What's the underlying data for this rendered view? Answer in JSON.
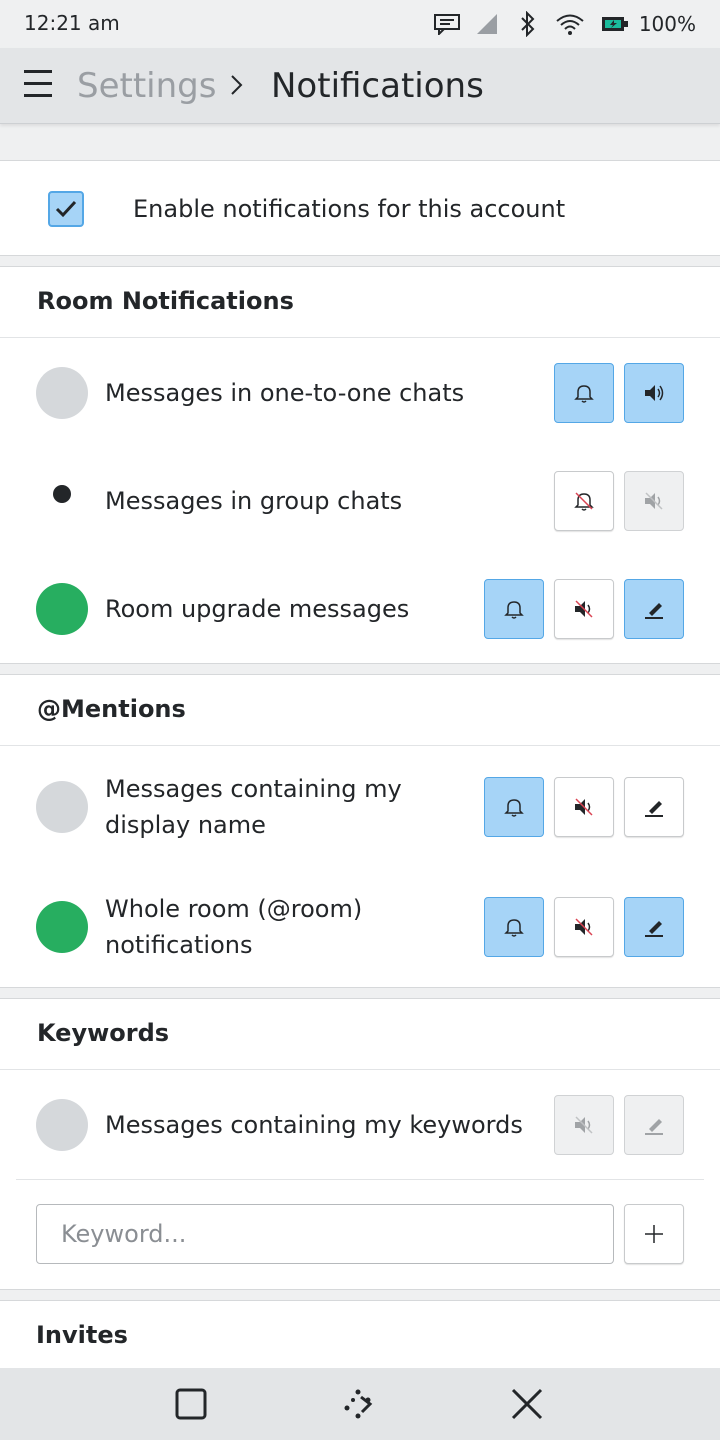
{
  "status_bar": {
    "time": "12:21 am",
    "battery": "100%",
    "icons": [
      "notification-icon",
      "signal-icon",
      "bluetooth-icon",
      "wifi-icon",
      "battery-icon"
    ]
  },
  "header": {
    "menu_icon": "hamburger-icon",
    "breadcrumb_parent": "Settings",
    "breadcrumb_current": "Notifications"
  },
  "account": {
    "enable_label": "Enable notifications for this account",
    "enabled": true
  },
  "sections": {
    "room": {
      "title": "Room Notifications",
      "items": [
        {
          "label": "Messages in one-to-one chats",
          "state": "notify-sound",
          "indicator": "#d5d8db"
        },
        {
          "label": "Messages in group chats",
          "state": "mention-only",
          "indicator": "#232629"
        },
        {
          "label": "Room upgrade messages",
          "state": "highlight",
          "indicator": "#27ae60"
        }
      ]
    },
    "mentions": {
      "title": "@Mentions",
      "items": [
        {
          "label_line1": "Messages containing my",
          "label_line2": "display name",
          "state": "notify",
          "indicator": "#d5d8db"
        },
        {
          "label_line1": "Whole room (@room)",
          "label_line2": "notifications",
          "state": "highlight",
          "indicator": "#27ae60"
        }
      ]
    },
    "keywords": {
      "title": "Keywords",
      "items": [
        {
          "label": "Messages containing my keywords",
          "state": "disabled",
          "indicator": "#d5d8db"
        }
      ],
      "input_placeholder": "Keyword...",
      "add_icon": "plus-icon"
    },
    "invites": {
      "title": "Invites"
    }
  },
  "colors": {
    "accent": "#a6d4f7",
    "accent_border": "#54a7e6",
    "highlight_green": "#27ae60",
    "inactive_grey": "#d5d8db"
  },
  "navbar": {
    "icons": [
      "overview-icon",
      "home-icon",
      "close-icon"
    ]
  }
}
